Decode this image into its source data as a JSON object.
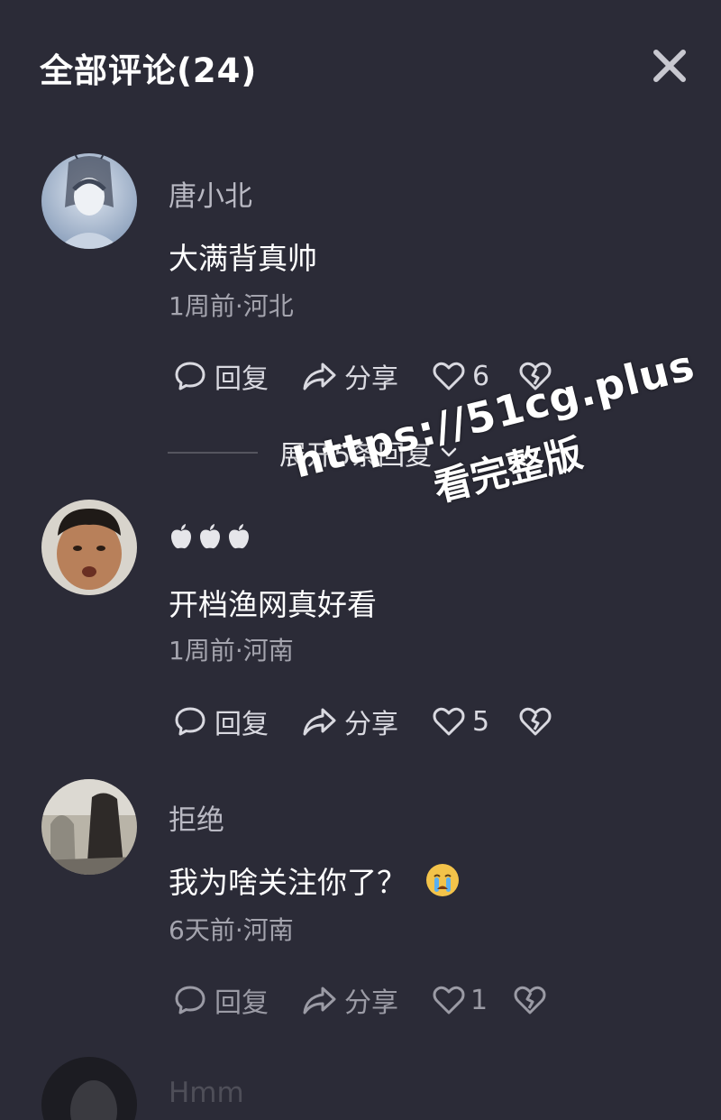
{
  "header": {
    "title": "全部评论(24)"
  },
  "comments": [
    {
      "username": "唐小北",
      "content": "大满背真帅",
      "meta": "1周前·河北",
      "reply_label": "回复",
      "share_label": "分享",
      "likes": "6"
    },
    {
      "username_icons": [
        "apple-icon",
        "apple-icon",
        "apple-icon"
      ],
      "content": "开档渔网真好看",
      "meta": "1周前·河南",
      "reply_label": "回复",
      "share_label": "分享",
      "likes": "5"
    },
    {
      "username": "拒绝",
      "content": "我为啥关注你了？",
      "content_emoji": "crying-face-icon",
      "meta": "6天前·河南",
      "reply_label": "回复",
      "share_label": "分享",
      "likes": "1"
    },
    {
      "username": "Hmm"
    }
  ],
  "expand": {
    "label": "展开5条回复"
  },
  "watermark": {
    "line1": "https://51cg.plus",
    "line2": "看完整版"
  },
  "colors": {
    "background": "#2b2b37",
    "text": "#ffffff",
    "secondary": "#a4a4ae"
  }
}
